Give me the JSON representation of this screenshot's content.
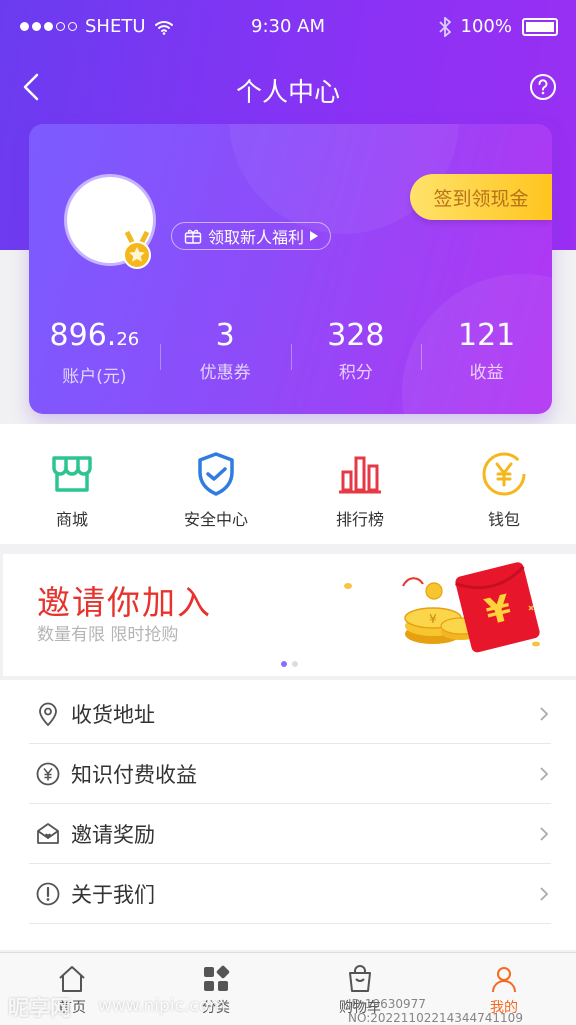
{
  "status": {
    "carrier": "SHETU",
    "time": "9:30 AM",
    "battery": "100%"
  },
  "nav": {
    "title": "个人中心"
  },
  "profile": {
    "welfare_label": "领取新人福利",
    "sign_label": "签到领现金",
    "stats": [
      {
        "value_main": "896.",
        "value_small": "26",
        "label": "账户(元)"
      },
      {
        "value_main": "3",
        "value_small": "",
        "label": "优惠券"
      },
      {
        "value_main": "328",
        "value_small": "",
        "label": "积分"
      },
      {
        "value_main": "121",
        "value_small": "",
        "label": "收益"
      }
    ]
  },
  "quick": [
    {
      "label": "商城",
      "icon": "store-icon",
      "color": "#2dc58f"
    },
    {
      "label": "安全中心",
      "icon": "shield-icon",
      "color": "#2f7de1"
    },
    {
      "label": "排行榜",
      "icon": "ranking-icon",
      "color": "#e63946"
    },
    {
      "label": "钱包",
      "icon": "wallet-yen-icon",
      "color": "#f5b81c"
    }
  ],
  "banner": {
    "title": "邀请你加入",
    "subtitle": "数量有限 限时抢购",
    "page_count": 2,
    "active_page": 1
  },
  "menu": [
    {
      "label": "收货地址",
      "icon": "location-pin-icon"
    },
    {
      "label": "知识付费收益",
      "icon": "yen-circle-icon"
    },
    {
      "label": "邀请奖励",
      "icon": "envelope-heart-icon"
    },
    {
      "label": "关于我们",
      "icon": "info-circle-icon"
    }
  ],
  "tabbar": [
    {
      "label": "首页",
      "icon": "home-icon"
    },
    {
      "label": "分类",
      "icon": "category-icon"
    },
    {
      "label": "购物车",
      "icon": "cart-bag-icon"
    },
    {
      "label": "我的",
      "icon": "user-icon",
      "active": true
    }
  ],
  "watermark": {
    "logo": "昵享网",
    "url": "www.nipic.com",
    "id": "ID:19630977 NO:20221102214344741109"
  },
  "colors": {
    "header_start": "#6a3cf0",
    "card_end": "#b335f3",
    "accent_orange": "#f36b21",
    "banner_red": "#e7332d"
  }
}
